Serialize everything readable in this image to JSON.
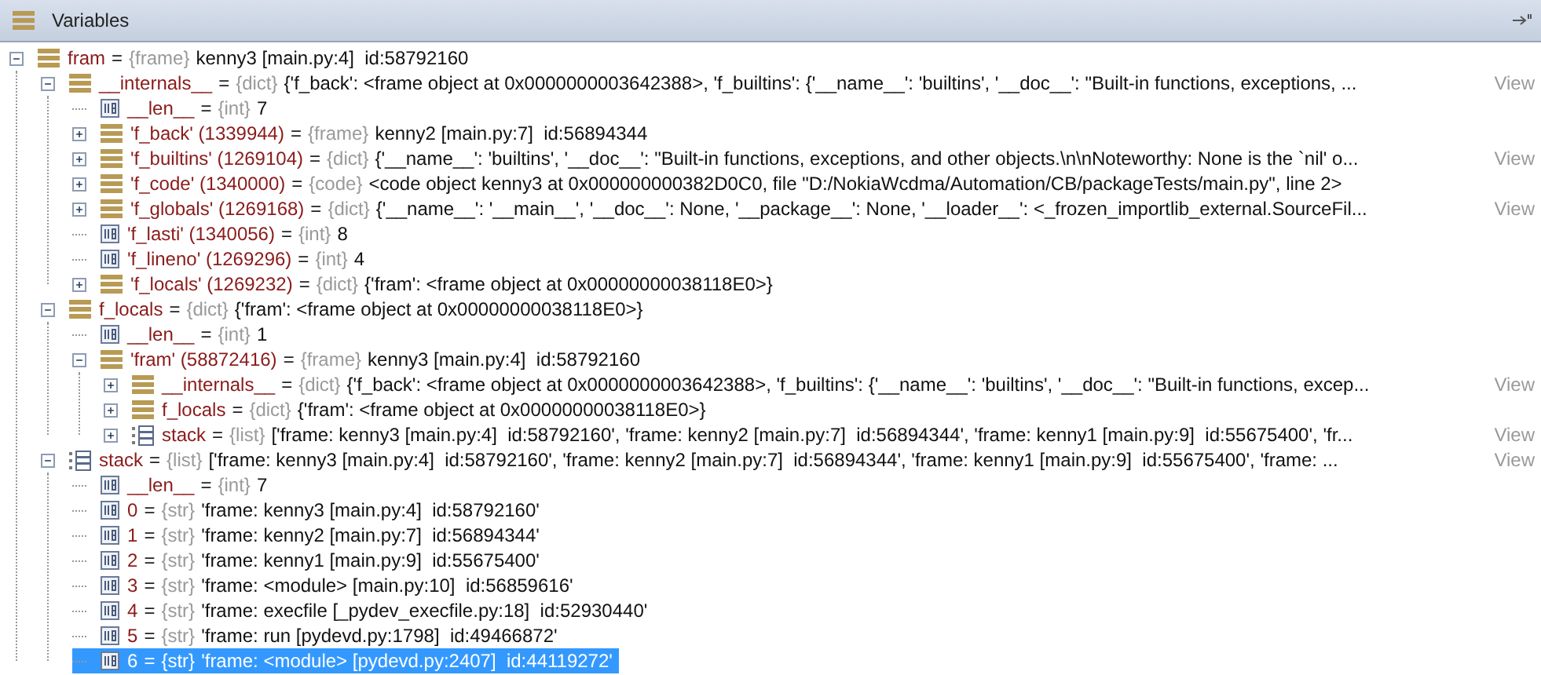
{
  "panel": {
    "title": "Variables"
  },
  "tree": [
    {
      "name": "fram",
      "eq": "=",
      "type": "{frame}",
      "value": "kenny3 [main.py:4]  id:58792160",
      "kind": "object",
      "expanded": true,
      "selected": false,
      "children": [
        {
          "name": "__internals__",
          "eq": "=",
          "type": "{dict}",
          "value": "{'f_back': <frame object at 0x0000000003642388>, 'f_builtins': {'__name__': 'builtins', '__doc__': \"Built-in functions, exceptions, ...",
          "view": "View",
          "kind": "object",
          "expanded": true,
          "selected": false,
          "children": [
            {
              "name": "__len__",
              "eq": "=",
              "type": "{int}",
              "value": "7",
              "kind": "value",
              "selected": false
            },
            {
              "name": "'f_back' (1339944)",
              "eq": "=",
              "type": "{frame}",
              "value": "kenny2 [main.py:7]  id:56894344",
              "kind": "object",
              "expanded": false,
              "selected": false
            },
            {
              "name": "'f_builtins' (1269104)",
              "eq": "=",
              "type": "{dict}",
              "value": "{'__name__': 'builtins', '__doc__': \"Built-in functions, exceptions, and other objects.\\n\\nNoteworthy: None is the `nil' o...",
              "view": "View",
              "kind": "object",
              "expanded": false,
              "selected": false
            },
            {
              "name": "'f_code' (1340000)",
              "eq": "=",
              "type": "{code}",
              "value": "<code object kenny3 at 0x000000000382D0C0, file \"D:/NokiaWcdma/Automation/CB/packageTests/main.py\", line 2>",
              "kind": "object",
              "expanded": false,
              "selected": false
            },
            {
              "name": "'f_globals' (1269168)",
              "eq": "=",
              "type": "{dict}",
              "value": "{'__name__': '__main__', '__doc__': None, '__package__': None, '__loader__': <_frozen_importlib_external.SourceFil...",
              "view": "View",
              "kind": "object",
              "expanded": false,
              "selected": false
            },
            {
              "name": "'f_lasti' (1340056)",
              "eq": "=",
              "type": "{int}",
              "value": "8",
              "kind": "value",
              "selected": false
            },
            {
              "name": "'f_lineno' (1269296)",
              "eq": "=",
              "type": "{int}",
              "value": "4",
              "kind": "value",
              "selected": false
            },
            {
              "name": "'f_locals' (1269232)",
              "eq": "=",
              "type": "{dict}",
              "value": "{'fram': <frame object at 0x00000000038118E0>}",
              "kind": "object",
              "expanded": false,
              "selected": false
            }
          ]
        },
        {
          "name": "f_locals",
          "eq": "=",
          "type": "{dict}",
          "value": "{'fram': <frame object at 0x00000000038118E0>}",
          "kind": "object",
          "expanded": true,
          "selected": false,
          "children": [
            {
              "name": "__len__",
              "eq": "=",
              "type": "{int}",
              "value": "1",
              "kind": "value",
              "selected": false
            },
            {
              "name": "'fram' (58872416)",
              "eq": "=",
              "type": "{frame}",
              "value": "kenny3 [main.py:4]  id:58792160",
              "kind": "object",
              "expanded": true,
              "selected": false,
              "children": [
                {
                  "name": "__internals__",
                  "eq": "=",
                  "type": "{dict}",
                  "value": "{'f_back': <frame object at 0x0000000003642388>, 'f_builtins': {'__name__': 'builtins', '__doc__': \"Built-in functions, excep...",
                  "view": "View",
                  "kind": "object",
                  "expanded": false,
                  "selected": false
                },
                {
                  "name": "f_locals",
                  "eq": "=",
                  "type": "{dict}",
                  "value": "{'fram': <frame object at 0x00000000038118E0>}",
                  "kind": "object",
                  "expanded": false,
                  "selected": false
                },
                {
                  "name": "stack",
                  "eq": "=",
                  "type": "{list}",
                  "value": "['frame: kenny3 [main.py:4]  id:58792160', 'frame: kenny2 [main.py:7]  id:56894344', 'frame: kenny1 [main.py:9]  id:55675400', 'fr...",
                  "view": "View",
                  "kind": "list",
                  "expanded": false,
                  "selected": false
                }
              ]
            }
          ]
        },
        {
          "name": "stack",
          "eq": "=",
          "type": "{list}",
          "value": "['frame: kenny3 [main.py:4]  id:58792160', 'frame: kenny2 [main.py:7]  id:56894344', 'frame: kenny1 [main.py:9]  id:55675400', 'frame: ...",
          "view": "View",
          "kind": "list",
          "expanded": true,
          "selected": false,
          "children": [
            {
              "name": "__len__",
              "eq": "=",
              "type": "{int}",
              "value": "7",
              "kind": "value",
              "selected": false
            },
            {
              "name": "0",
              "eq": "=",
              "type": "{str}",
              "value": "'frame: kenny3 [main.py:4]  id:58792160'",
              "kind": "value",
              "selected": false
            },
            {
              "name": "1",
              "eq": "=",
              "type": "{str}",
              "value": "'frame: kenny2 [main.py:7]  id:56894344'",
              "kind": "value",
              "selected": false
            },
            {
              "name": "2",
              "eq": "=",
              "type": "{str}",
              "value": "'frame: kenny1 [main.py:9]  id:55675400'",
              "kind": "value",
              "selected": false
            },
            {
              "name": "3",
              "eq": "=",
              "type": "{str}",
              "value": "'frame: <module> [main.py:10]  id:56859616'",
              "kind": "value",
              "selected": false
            },
            {
              "name": "4",
              "eq": "=",
              "type": "{str}",
              "value": "'frame: execfile [_pydev_execfile.py:18]  id:52930440'",
              "kind": "value",
              "selected": false
            },
            {
              "name": "5",
              "eq": "=",
              "type": "{str}",
              "value": "'frame: run [pydevd.py:1798]  id:49466872'",
              "kind": "value",
              "selected": false
            },
            {
              "name": "6",
              "eq": "=",
              "type": "{str}",
              "value": "'frame: <module> [pydevd.py:2407]  id:44119272'",
              "kind": "value",
              "selected": true
            }
          ]
        }
      ]
    }
  ]
}
